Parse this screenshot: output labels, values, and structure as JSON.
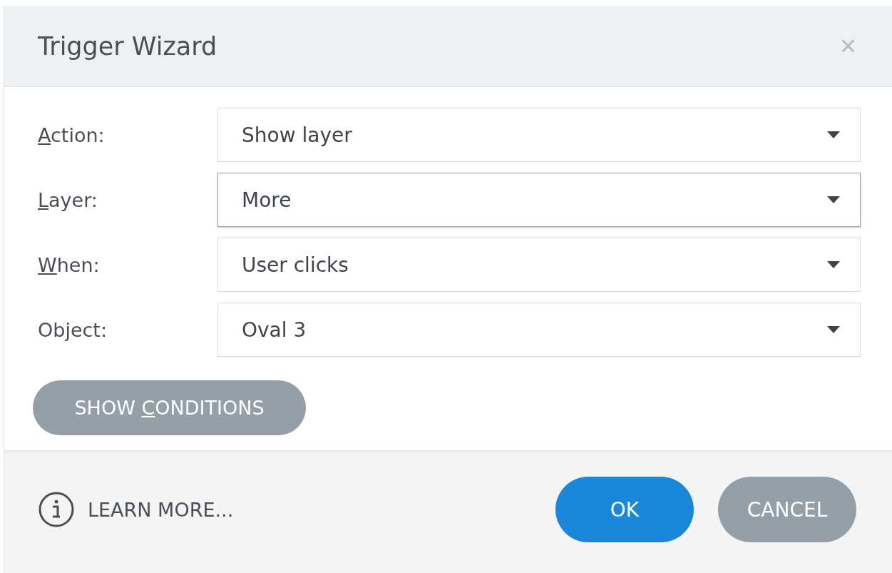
{
  "window": {
    "title": "Trigger Wizard",
    "close": "×"
  },
  "fields": [
    {
      "label": {
        "key": "A",
        "rest": "ction:"
      },
      "value": "Show layer",
      "focused": false
    },
    {
      "label": {
        "key": "L",
        "rest": "ayer:"
      },
      "value": "More",
      "focused": true
    },
    {
      "label": {
        "key": "W",
        "rest": "hen:"
      },
      "value": "User clicks",
      "focused": false
    },
    {
      "label": {
        "rest": "Object:"
      },
      "value": "Oval 3",
      "focused": false
    }
  ],
  "conditions_button": {
    "before": "SHOW ",
    "key": "C",
    "rest": "ONDITIONS"
  },
  "footer": {
    "learn_more": "LEARN MORE...",
    "buttons": [
      {
        "label": "OK",
        "kind": "primary"
      },
      {
        "label": "CANCEL",
        "kind": "secondary"
      }
    ]
  }
}
